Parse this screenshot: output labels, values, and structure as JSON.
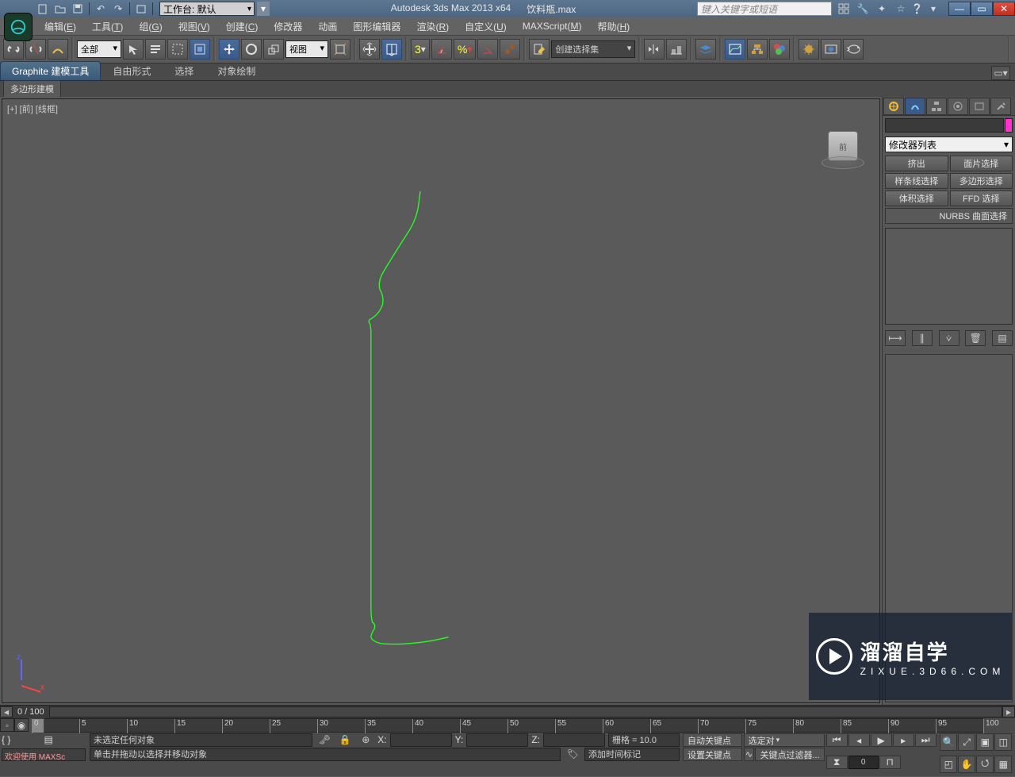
{
  "title": {
    "app": "Autodesk 3ds Max  2013 x64",
    "file": "饮料瓶.max"
  },
  "workspace": "工作台: 默认",
  "search_placeholder": "键入关键字或短语",
  "menus": [
    {
      "label": "编辑",
      "accel": "E"
    },
    {
      "label": "工具",
      "accel": "T"
    },
    {
      "label": "组",
      "accel": "G"
    },
    {
      "label": "视图",
      "accel": "V"
    },
    {
      "label": "创建",
      "accel": "C"
    },
    {
      "label": "修改器",
      "accel": ""
    },
    {
      "label": "动画",
      "accel": ""
    },
    {
      "label": "图形编辑器",
      "accel": ""
    },
    {
      "label": "渲染",
      "accel": "R"
    },
    {
      "label": "自定义",
      "accel": "U"
    },
    {
      "label": "MAXScript",
      "accel": "M"
    },
    {
      "label": "帮助",
      "accel": "H"
    }
  ],
  "toolbar": {
    "filter_dd": "全部",
    "refsys_dd": "视图",
    "named_sets_dd": "创建选择集"
  },
  "ribbon": {
    "tabs": [
      "Graphite 建模工具",
      "自由形式",
      "选择",
      "对象绘制"
    ],
    "active": 0,
    "sub_button": "多边形建模"
  },
  "viewport_label": "[+] [前] [线框]",
  "viewcube_face": "前",
  "cmd_panel": {
    "modifier_list_label": "修改器列表",
    "buttons": [
      [
        "挤出",
        "面片选择"
      ],
      [
        "样条线选择",
        "多边形选择"
      ],
      [
        "体积选择",
        "FFD 选择"
      ]
    ],
    "nurbs_btn": "NURBS 曲面选择"
  },
  "timeline": {
    "frame_indicator": "0 / 100",
    "ticks": [
      0,
      5,
      10,
      15,
      20,
      25,
      30,
      35,
      40,
      45,
      50,
      55,
      60,
      65,
      70,
      75,
      80,
      85,
      90,
      95,
      100
    ],
    "current_frame_input": "0"
  },
  "status": {
    "welcome": "欢迎使用  MAXSc",
    "selected": "未选定任何对象",
    "hint": "单击并拖动以选择并移动对象",
    "x_label": "X:",
    "y_label": "Y:",
    "z_label": "Z:",
    "grid": "栅格 = 10.0",
    "add_time_tag": "添加时间标记",
    "auto_key": "自动关键点",
    "set_key": "设置关键点",
    "selected_obj_dd": "选定对",
    "key_filter": "关键点过滤器..."
  },
  "watermark": {
    "big": "溜溜自学",
    "small": "ZIXUE.3D66.COM"
  }
}
